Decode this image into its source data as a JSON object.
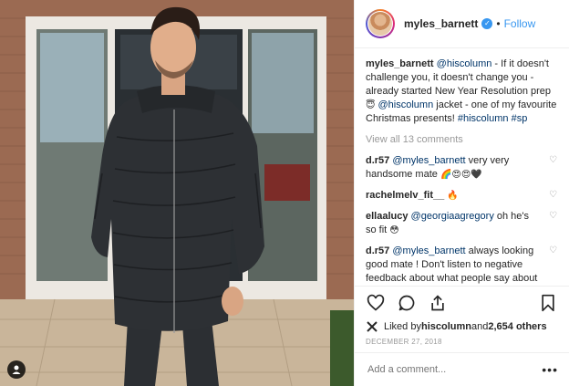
{
  "header": {
    "username": "myles_barnett",
    "dot": "•",
    "follow": "Follow"
  },
  "caption": {
    "username": "myles_barnett",
    "parts": [
      "@hiscolumn",
      " - If it doesn't challenge you, it doesn't change you - already started New Year Resolution prep ",
      "😇",
      "@hiscolumn",
      " jacket - one of my favourite Christmas presents! ",
      "#hiscolumn",
      " ",
      "#sp"
    ]
  },
  "view_all": "View all 13 comments",
  "comments": [
    {
      "user": "d.r57",
      "mention": "@myles_barnett",
      "text": " very very handsome mate ",
      "emoji": "🌈😍😍🖤"
    },
    {
      "user": "rachelmelv_fit__",
      "mention": "",
      "text": " ",
      "emoji": "🔥"
    },
    {
      "user": "ellaalucy",
      "mention": "@georgiaagregory",
      "text": " oh he's so fit ",
      "emoji": "😳"
    },
    {
      "user": "d.r57",
      "mention": "@myles_barnett",
      "text": " always looking good mate ! Don't listen to negative feedback about what people say about you ! You've always been cool with me ",
      "emoji": "😘💯"
    }
  ],
  "likes": {
    "prefix": "Liked by ",
    "user": "hiscolumn",
    "middle": " and ",
    "count": "2,654 others"
  },
  "date": "DECEMBER 27, 2018",
  "add_comment": {
    "placeholder": "Add a comment..."
  },
  "more": "•••",
  "colors": {
    "accent": "#3897f0",
    "mention": "#003569",
    "muted": "#999999"
  }
}
